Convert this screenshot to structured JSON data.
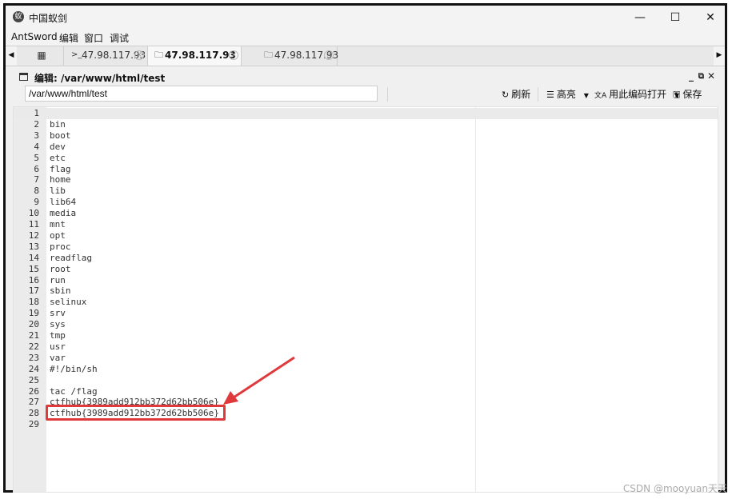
{
  "window": {
    "title": "中国蚁剑",
    "minimize": "—",
    "maximize": "☐",
    "close": "✕"
  },
  "menu": [
    "AntSword",
    "编辑",
    "窗口",
    "调试"
  ],
  "tabs": [
    {
      "label": "47.98.117.93",
      "icon": ">_"
    },
    {
      "label": "47.98.117.93",
      "icon": "folder-icon",
      "active": true
    },
    {
      "label": "47.98.117.93",
      "icon": "folder-icon"
    }
  ],
  "panel": {
    "title": "编辑: /var/www/html/test"
  },
  "toolbar": {
    "path_value": "/var/www/html/test",
    "refresh": "刷新",
    "highlight": "高亮",
    "open_with_encoding": "用此编码打开",
    "save": "保存"
  },
  "editor": {
    "lines": [
      "",
      "bin",
      "boot",
      "dev",
      "etc",
      "flag",
      "home",
      "lib",
      "lib64",
      "media",
      "mnt",
      "opt",
      "proc",
      "readflag",
      "root",
      "run",
      "sbin",
      "selinux",
      "srv",
      "sys",
      "tmp",
      "usr",
      "var",
      "#!/bin/sh",
      "",
      "tac /flag",
      "ctfhub{3989add912bb372d62bb506e}",
      "ctfhub{3989add912bb372d62bb506e}",
      ""
    ],
    "line_numbers": [
      "1",
      "2",
      "3",
      "4",
      "5",
      "6",
      "7",
      "8",
      "9",
      "10",
      "11",
      "12",
      "13",
      "14",
      "15",
      "16",
      "17",
      "18",
      "19",
      "20",
      "21",
      "22",
      "23",
      "24",
      "25",
      "26",
      "27",
      "28",
      "29"
    ]
  },
  "annotation": {
    "color": "#e0393c"
  },
  "watermark": "CSDN @mooyuan天天"
}
